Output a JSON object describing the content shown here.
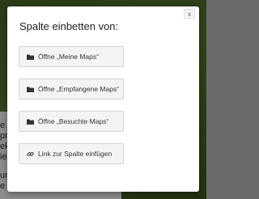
{
  "background": {
    "side_text": [
      "e s",
      "pr",
      "ek",
      "ie",
      "",
      "um",
      "e k"
    ]
  },
  "dialog": {
    "title": "Spalte einbetten von:",
    "close_label": "x",
    "options": [
      {
        "label": "Öffne „Meine Maps“",
        "icon": "folder-icon"
      },
      {
        "label": "Öffne „Empfangene Maps“",
        "icon": "folder-icon"
      },
      {
        "label": "Öffne „Besuchte Maps“",
        "icon": "folder-icon"
      },
      {
        "label": "Link zur Spalte einfügen",
        "icon": "link-icon"
      }
    ]
  }
}
